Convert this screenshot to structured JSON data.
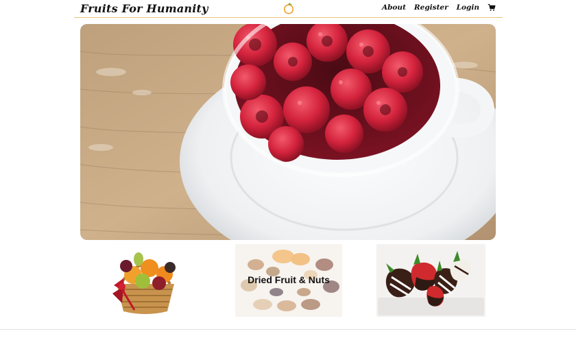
{
  "header": {
    "brand": "Fruits For Humanity",
    "logo_icon": "orange-fruit-icon",
    "nav": [
      {
        "label": "About"
      },
      {
        "label": "Register"
      },
      {
        "label": "Login"
      }
    ],
    "cart_icon": "shopping-cart-icon"
  },
  "hero": {
    "image": "raspberries-in-white-cup-photo"
  },
  "categories": [
    {
      "image": "fruit-basket-photo",
      "label": ""
    },
    {
      "image": "dried-fruit-nuts-photo",
      "label": "Dried Fruit & Nuts"
    },
    {
      "image": "chocolate-dipped-strawberries-photo",
      "label": ""
    }
  ],
  "colors": {
    "nav_underline": "#e9c17a",
    "raspberry": "#d92b45",
    "wood": "#c9a77e",
    "cup": "#f4f5f6"
  }
}
